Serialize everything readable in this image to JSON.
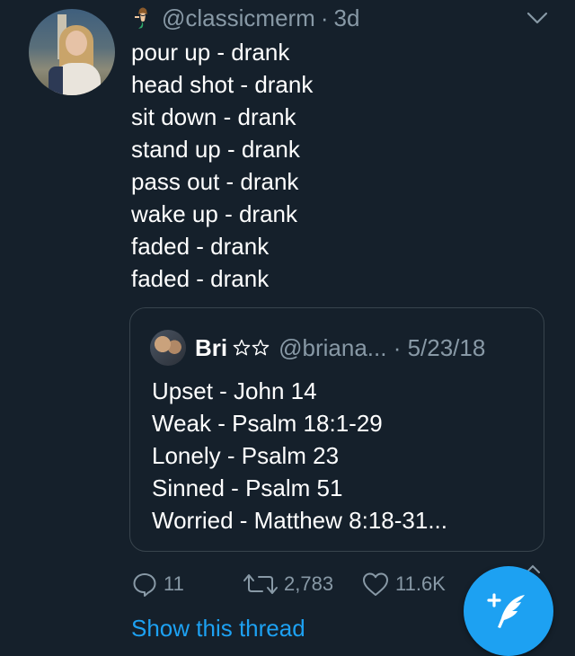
{
  "tweet": {
    "handle": "@classicmerm",
    "separator": "·",
    "time": "3d",
    "lines": [
      "pour up - drank",
      "head shot - drank",
      "sit down - drank",
      "stand up - drank",
      "pass out - drank",
      "wake up - drank",
      "faded - drank",
      "faded - drank"
    ]
  },
  "quoted_tweet": {
    "name": "Bri",
    "stars_icon": "star-outline-icon",
    "handle_time": "@briana... · 5/23/18",
    "lines": [
      "Upset - John 14",
      "Weak - Psalm 18:1-29",
      "Lonely - Psalm 23",
      "Sinned - Psalm 51",
      "Worried - Matthew 8:18-31..."
    ]
  },
  "actions": {
    "replies": "11",
    "retweets": "2,783",
    "likes": "11.6K"
  },
  "show_thread": "Show this thread",
  "colors": {
    "background": "#15202b",
    "secondary_text": "#8899a6",
    "accent": "#1da1f2",
    "border": "#38444d"
  }
}
